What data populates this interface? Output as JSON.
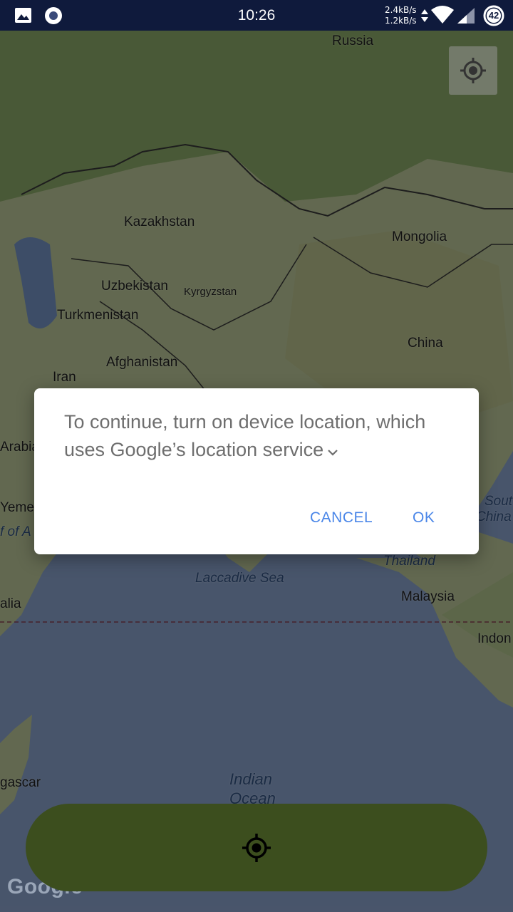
{
  "status_bar": {
    "time": "10:26",
    "upload_speed": "2.4kB/s",
    "download_speed": "1.2kB/s",
    "battery_level": "42",
    "icons": [
      "image-icon",
      "record-icon",
      "wifi-icon",
      "cell-signal-icon",
      "battery-icon"
    ]
  },
  "map": {
    "labels": {
      "russia": "Russia",
      "kazakhstan": "Kazakhstan",
      "mongolia": "Mongolia",
      "uzbekistan": "Uzbekistan",
      "kyrgyzstan": "Kyrgyzstan",
      "turkmenistan": "Turkmenistan",
      "afghanistan": "Afghanistan",
      "china": "China",
      "iran": "Iran",
      "arabia": "Arabia",
      "yemen": "Yemen",
      "gulf_of_aden": "f of A",
      "south_china_sea_1": "Sout",
      "south_china_sea_2": "China S",
      "thailand": "Thailand",
      "laccadive_sea": "Laccadive Sea",
      "malaysia": "Malaysia",
      "somalia": "alia",
      "indonesia": "Indon",
      "madagascar": "gascar",
      "indian_ocean_1": "Indian",
      "indian_ocean_2": "Ocean"
    },
    "attribution": "Google"
  },
  "dialog": {
    "message": "To continue, turn on device location, which uses Google’s location service",
    "cancel_label": "CANCEL",
    "ok_label": "OK"
  },
  "colors": {
    "status_bar": "#0f1a3c",
    "dialog_button": "#4a86e8",
    "bottom_pill": "#3c4e1e"
  }
}
